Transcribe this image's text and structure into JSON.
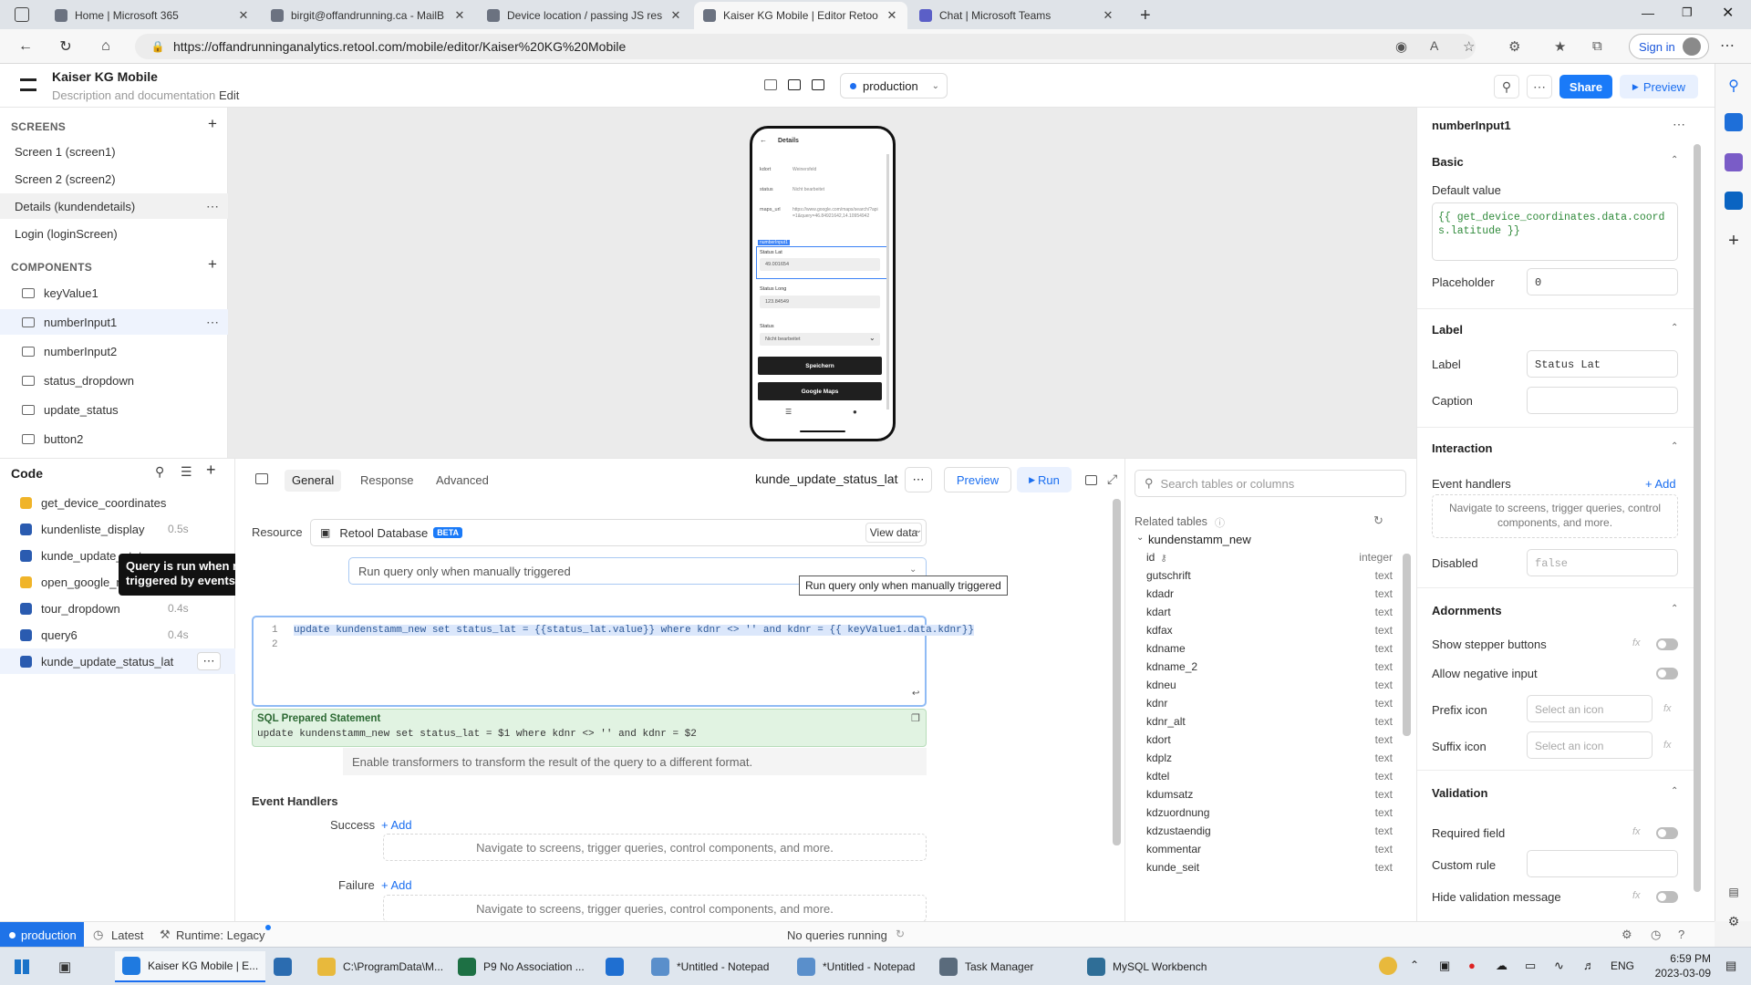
{
  "browser": {
    "tabs": [
      {
        "title": "Home | Microsoft 365",
        "color": "#6b7280",
        "active": false
      },
      {
        "title": "birgit@offandrunning.ca - MailB",
        "color": "#6b7280",
        "active": false
      },
      {
        "title": "Device location / passing JS resu",
        "color": "#6b7280",
        "active": false
      },
      {
        "title": "Kaiser KG Mobile | Editor Retool",
        "color": "#6b7280",
        "active": true
      },
      {
        "title": "Chat | Microsoft Teams",
        "color": "#5b5fc7",
        "active": false
      }
    ],
    "url": "https://offandrunninganalytics.retool.com/mobile/editor/Kaiser%20KG%20Mobile",
    "signin_label": "Sign in"
  },
  "header": {
    "app_title": "Kaiser KG Mobile",
    "description": "Description and documentation",
    "edit_label": "Edit",
    "environment": "production",
    "share_label": "Share",
    "preview_label": "Preview"
  },
  "sidebar": {
    "screens_heading": "SCREENS",
    "screens": [
      {
        "label": "Screen 1 (screen1)",
        "selected": false
      },
      {
        "label": "Screen 2 (screen2)",
        "selected": false
      },
      {
        "label": "Details (kundendetails)",
        "selected": true
      },
      {
        "label": "Login (loginScreen)",
        "selected": false
      }
    ],
    "components_heading": "COMPONENTS",
    "components": [
      {
        "label": "keyValue1",
        "selected": false
      },
      {
        "label": "numberInput1",
        "selected": true
      },
      {
        "label": "numberInput2",
        "selected": false
      },
      {
        "label": "status_dropdown",
        "selected": false
      },
      {
        "label": "update_status",
        "selected": false
      },
      {
        "label": "button2",
        "selected": false
      }
    ]
  },
  "phone": {
    "title": "Details",
    "rows": [
      {
        "key": "kdort",
        "value": "Weinersfeld"
      },
      {
        "key": "status",
        "value": "Nicht bearbeitet"
      },
      {
        "key": "maps_url",
        "value": "https://www.google.com/maps/search/?api=1&query=46.84921642,14.10954942"
      }
    ],
    "selected_tag": "numberInput1",
    "status_lat_label": "Status Lat",
    "status_lat_value": "49.001654",
    "status_long_label": "Status Long",
    "status_long_value": "123.84549",
    "status_label": "Status",
    "status_value": "Nicht bearbeitet",
    "save_button": "Speichern",
    "maps_button": "Google Maps"
  },
  "code": {
    "heading": "Code",
    "queries": [
      {
        "name": "get_device_coordinates",
        "time": "",
        "kind": "js",
        "selected": false
      },
      {
        "name": "kundenliste_display",
        "time": "0.5s",
        "kind": "db",
        "selected": false
      },
      {
        "name": "kunde_update_status",
        "time": "",
        "kind": "db",
        "selected": false
      },
      {
        "name": "open_google_maps",
        "time": "",
        "kind": "js",
        "selected": false
      },
      {
        "name": "tour_dropdown",
        "time": "0.4s",
        "kind": "db",
        "selected": false
      },
      {
        "name": "query6",
        "time": "0.4s",
        "kind": "db",
        "selected": false
      },
      {
        "name": "kunde_update_status_lat",
        "time": "",
        "kind": "db",
        "selected": true
      }
    ],
    "tooltip": "Query is run when manually triggered by events."
  },
  "query": {
    "tabs": [
      "General",
      "Response",
      "Advanced"
    ],
    "active_tab": "General",
    "name": "kunde_update_status_lat",
    "preview_label": "Preview",
    "run_label": "Run",
    "resource_label": "Resource",
    "resource_value": "Retool Database",
    "beta_badge": "BETA",
    "view_data_label": "View data",
    "trigger_value": "Run query only when manually triggered",
    "trigger_tooltip": "Run query only when manually triggered",
    "code_lines": [
      "update kundenstamm_new set status_lat = {{status_lat.value}} where kdnr <> '' and kdnr = {{ keyValue1.data.kdnr}}",
      ""
    ],
    "prepared_title": "SQL Prepared Statement",
    "prepared_sql": "update kundenstamm_new set status_lat = $1 where kdnr <> '' and kdnr = $2",
    "transform_note": "Enable transformers to transform the result of the query to a different format.",
    "event_handlers_heading": "Event Handlers",
    "success_label": "Success",
    "failure_label": "Failure",
    "add_label": "+ Add",
    "handler_placeholder": "Navigate to screens, trigger queries, control components, and more."
  },
  "tables": {
    "search_placeholder": "Search tables or columns",
    "related_heading": "Related tables",
    "table_name": "kundenstamm_new",
    "columns": [
      {
        "name": "id",
        "type": "integer"
      },
      {
        "name": "gutschrift",
        "type": "text"
      },
      {
        "name": "kdadr",
        "type": "text"
      },
      {
        "name": "kdart",
        "type": "text"
      },
      {
        "name": "kdfax",
        "type": "text"
      },
      {
        "name": "kdname",
        "type": "text"
      },
      {
        "name": "kdname_2",
        "type": "text"
      },
      {
        "name": "kdneu",
        "type": "text"
      },
      {
        "name": "kdnr",
        "type": "text"
      },
      {
        "name": "kdnr_alt",
        "type": "text"
      },
      {
        "name": "kdort",
        "type": "text"
      },
      {
        "name": "kdplz",
        "type": "text"
      },
      {
        "name": "kdtel",
        "type": "text"
      },
      {
        "name": "kdumsatz",
        "type": "text"
      },
      {
        "name": "kdzuordnung",
        "type": "text"
      },
      {
        "name": "kdzustaendig",
        "type": "text"
      },
      {
        "name": "kommentar",
        "type": "text"
      },
      {
        "name": "kunde_seit",
        "type": "text"
      }
    ]
  },
  "inspector": {
    "component_name": "numberInput1",
    "basic_heading": "Basic",
    "default_value_label": "Default value",
    "default_value": "{{ get_device_coordinates.data.coords.latitude }}",
    "placeholder_label": "Placeholder",
    "placeholder_value": "0",
    "label_heading": "Label",
    "label_label": "Label",
    "label_value": "Status Lat",
    "caption_label": "Caption",
    "interaction_heading": "Interaction",
    "event_handlers_label": "Event handlers",
    "add_label": "+ Add",
    "handler_placeholder": "Navigate to screens, trigger queries, control components, and more.",
    "disabled_label": "Disabled",
    "disabled_value": "false",
    "adornments_heading": "Adornments",
    "show_stepper_label": "Show stepper buttons",
    "allow_negative_label": "Allow negative input",
    "prefix_icon_label": "Prefix icon",
    "suffix_icon_label": "Suffix icon",
    "select_icon_placeholder": "Select an icon",
    "validation_heading": "Validation",
    "required_label": "Required field",
    "custom_rule_label": "Custom rule",
    "hide_validation_label": "Hide validation message",
    "fx_label": "fx"
  },
  "statusbar": {
    "environment": "production",
    "latest_label": "Latest",
    "runtime_label": "Runtime: Legacy",
    "queries_status": "No queries running"
  },
  "taskbar": {
    "items": [
      {
        "label": "Kaiser KG Mobile | E...",
        "color": "#1f7ae0",
        "active": true
      },
      {
        "label": "",
        "color": "#2b6cb0",
        "active": false
      },
      {
        "label": "C:\\ProgramData\\M...",
        "color": "#e8b93c",
        "active": false
      },
      {
        "label": "P9 No Association ...",
        "color": "#1d7044",
        "active": false
      },
      {
        "label": "",
        "color": "#1f6fd1",
        "active": false
      },
      {
        "label": "*Untitled - Notepad",
        "color": "#5a8fcb",
        "active": false
      },
      {
        "label": "*Untitled - Notepad",
        "color": "#5a8fcb",
        "active": false
      },
      {
        "label": "Task Manager",
        "color": "#5a6b7c",
        "active": false
      },
      {
        "label": "MySQL Workbench",
        "color": "#2f6e97",
        "active": false
      }
    ],
    "language": "ENG",
    "time": "6:59 PM",
    "date": "2023-03-09"
  }
}
